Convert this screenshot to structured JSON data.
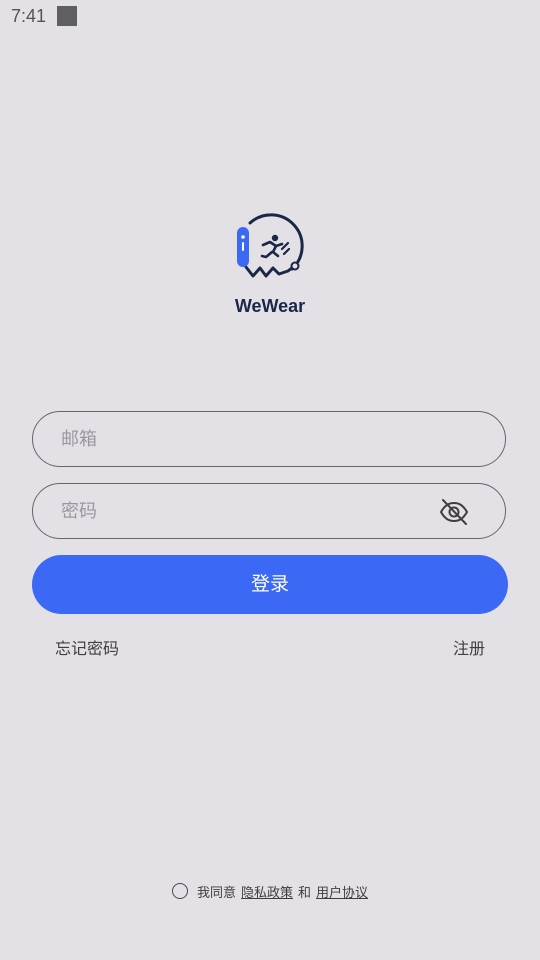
{
  "status_bar": {
    "time": "7:41"
  },
  "app": {
    "name": "WeWear",
    "logo_icon": "wewear-logo-icon",
    "brand_color": "#3b69f6",
    "dark_color": "#1b2746"
  },
  "form": {
    "email_placeholder": "邮箱",
    "email_value": "",
    "password_placeholder": "密码",
    "password_value": "",
    "visibility_icon": "eye-off-icon",
    "login_label": "登录",
    "forgot_password_label": "忘记密码",
    "register_label": "注册"
  },
  "agreement": {
    "prefix": "我同意",
    "privacy_label": "隐私政策",
    "conjunction": "和",
    "terms_label": "用户协议",
    "checked": false
  }
}
